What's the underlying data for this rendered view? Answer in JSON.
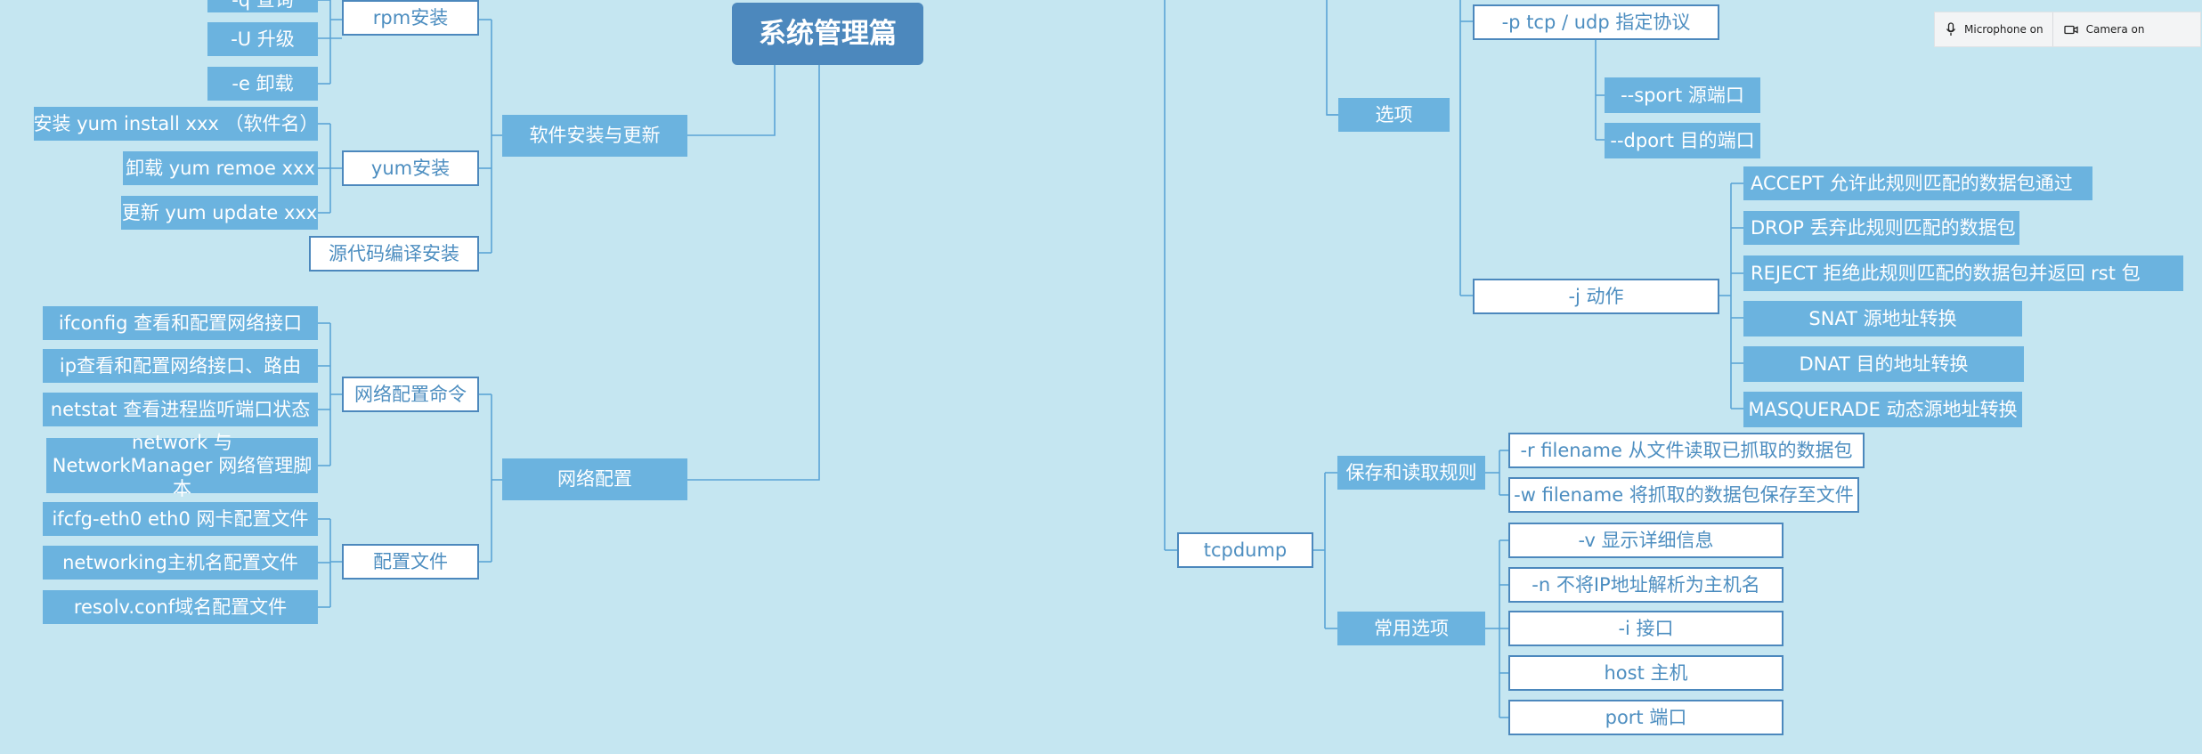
{
  "root_title": "系统管理篇",
  "left": {
    "software": {
      "label": "软件安装与更新",
      "rpm": {
        "label": "rpm安装",
        "items": [
          "-q 查询",
          "-U 升级",
          "-e 卸载"
        ]
      },
      "yum": {
        "label": "yum安装",
        "items": [
          "安装 yum install xxx （软件名）",
          "卸载 yum remoe xxx",
          "更新 yum update xxx"
        ]
      },
      "source": "源代码编译安装"
    },
    "network": {
      "label": "网络配置",
      "commands": {
        "label": "网络配置命令",
        "items": [
          "ifconfig 查看和配置网络接口",
          "ip查看和配置网络接口、路由",
          "netstat 查看进程监听端口状态",
          "network 与 NetworkManager 网络管理脚本"
        ]
      },
      "config_files": {
        "label": "配置文件",
        "items": [
          "ifcfg-eth0 eth0 网卡配置文件",
          "networking主机名配置文件",
          "resolv.conf域名配置文件"
        ]
      }
    }
  },
  "right": {
    "options": {
      "label": "选项",
      "protocol": "-p tcp / udp 指定协议",
      "ports": [
        "--sport 源端口",
        "--dport 目的端口"
      ],
      "action": {
        "label": "-j 动作",
        "items": [
          "ACCEPT 允许此规则匹配的数据包通过",
          "DROP 丢弃此规则匹配的数据包",
          "REJECT 拒绝此规则匹配的数据包并返回 rst 包",
          "SNAT 源地址转换",
          "DNAT 目的地址转换",
          "MASQUERADE 动态源地址转换"
        ]
      }
    },
    "tcpdump": {
      "label": "tcpdump",
      "save_read": {
        "label": "保存和读取规则",
        "items": [
          "-r filename 从文件读取已抓取的数据包",
          "-w filename 将抓取的数据包保存至文件"
        ]
      },
      "common": {
        "label": "常用选项",
        "items": [
          "-v 显示详细信息",
          "-n 不将IP地址解析为主机名",
          "-i 接口",
          "host 主机",
          "port 端口"
        ]
      }
    }
  },
  "call_controls": {
    "microphone": "Microphone on",
    "camera": "Camera on"
  },
  "colors": {
    "background": "#c5e6f1",
    "node_fill": "#6bb3df",
    "node_border": "#4c88bd",
    "line": "#5ba4d6",
    "outline_text": "#4d8ec0"
  }
}
